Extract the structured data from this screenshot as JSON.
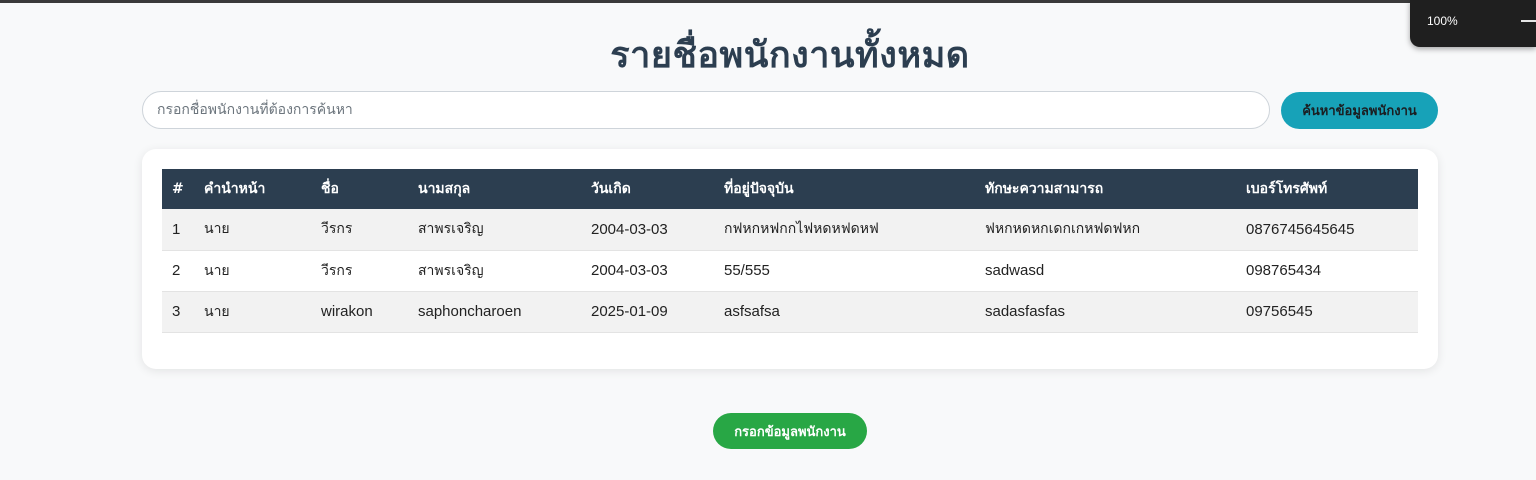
{
  "browser": {
    "zoom_level": "100%",
    "zoom_minus_icon": "minus-icon"
  },
  "page": {
    "title": "รายชื่อพนักงานทั้งหมด"
  },
  "search": {
    "placeholder": "กรอกชื่อพนักงานที่ต้องการค้นหา",
    "value": "",
    "button_label": "ค้นหาข้อมูลพนักงาน"
  },
  "table": {
    "headers": [
      "#",
      "คำนำหน้า",
      "ชื่อ",
      "นามสกุล",
      "วันเกิด",
      "ที่อยู่ปัจจุบัน",
      "ทักษะความสามารถ",
      "เบอร์โทรศัพท์"
    ],
    "rows": [
      [
        "1",
        "นาย",
        "วีรกร",
        "สาพรเจริญ",
        "2004-03-03",
        "กฟหกหฟกกไฟหดหฟดหฟ",
        "ฟหกหดหกเดกเกหฟดฟหก",
        "0876745645645"
      ],
      [
        "2",
        "นาย",
        "วีรกร",
        "สาพรเจริญ",
        "2004-03-03",
        "55/555",
        "sadwasd",
        "098765434"
      ],
      [
        "3",
        "นาย",
        "wirakon",
        "saphoncharoen",
        "2025-01-09",
        "asfsafsa",
        "sadasfasfas",
        "09756545"
      ]
    ]
  },
  "actions": {
    "add_button_label": "กรอกข้อมูลพนักงาน"
  },
  "colors": {
    "header_bg": "#2c3e50",
    "search_button": "#17a2b8",
    "add_button": "#28a745",
    "page_bg": "#f8f9fa"
  }
}
